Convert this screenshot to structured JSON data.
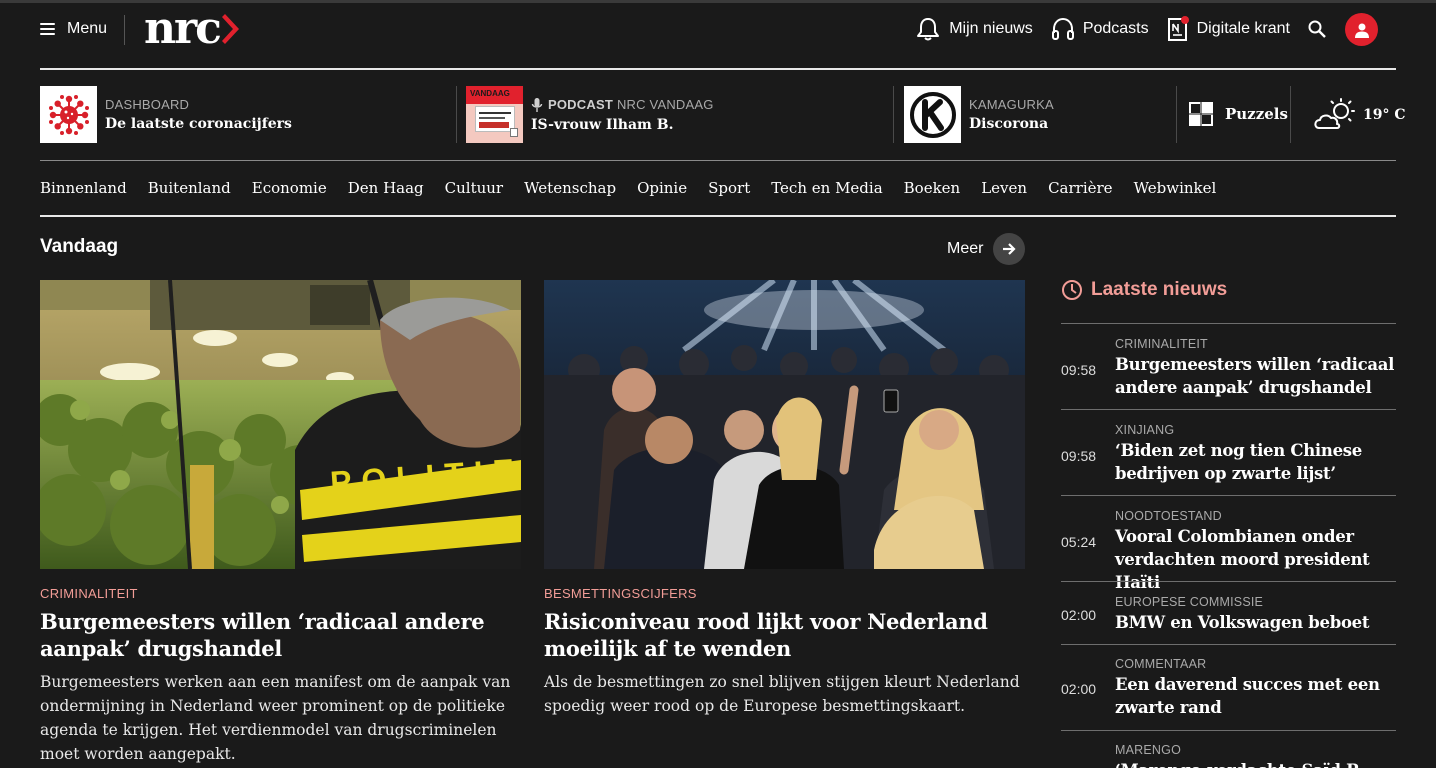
{
  "header": {
    "menu_label": "Menu",
    "logo_text": "nrc",
    "nav": [
      {
        "label": "Mijn nieuws",
        "icon": "bell-icon"
      },
      {
        "label": "Podcasts",
        "icon": "headphones-icon"
      },
      {
        "label": "Digitale krant",
        "icon": "newspaper-icon"
      }
    ]
  },
  "promos": [
    {
      "kicker_strong": "",
      "kicker": "DASHBOARD",
      "title": "De laatste coronacijfers",
      "icon": "virus-icon"
    },
    {
      "kicker_strong": "PODCAST",
      "kicker": "NRC VANDAAG",
      "title": "IS-vrouw Ilham B.",
      "icon": "podcast-cover",
      "cover_text": "VANDAAG"
    },
    {
      "kicker_strong": "",
      "kicker": "KAMAGURKA",
      "title": "Discorona",
      "icon": "kamagurka-k-logo"
    }
  ],
  "puzzels_label": "Puzzels",
  "weather": {
    "temp": "19° C",
    "icon": "partly-cloudy-icon"
  },
  "sections": [
    "Binnenland",
    "Buitenland",
    "Economie",
    "Den Haag",
    "Cultuur",
    "Wetenschap",
    "Opinie",
    "Sport",
    "Tech en Media",
    "Boeken",
    "Leven",
    "Carrière",
    "Webwinkel"
  ],
  "today": {
    "heading": "Vandaag",
    "more_label": "Meer",
    "articles": [
      {
        "kicker": "CRIMINALITEIT",
        "title": "Burgemeesters willen ‘radicaal andere aanpak’ drugshandel",
        "lede": "Burgemeesters werken aan een manifest om de aanpak van ondermijning in Nederland weer prominent op de politieke agenda te krijgen. Het verdienmodel van drugscriminelen moet worden aangepakt.",
        "image_text": "POLITIE"
      },
      {
        "kicker": "BESMETTINGSCIJFERS",
        "title": "Risiconiveau rood lijkt voor Nederland moeilijk af te wenden",
        "lede": "Als de besmettingen zo snel blijven stijgen kleurt Nederland spoedig weer rood op de Europese besmettingskaart."
      }
    ]
  },
  "latest": {
    "heading": "Laatste nieuws",
    "items": [
      {
        "time": "09:58",
        "kicker": "CRIMINALITEIT",
        "title": "Burgemeesters willen ‘radicaal andere aanpak’ drugshandel"
      },
      {
        "time": "09:58",
        "kicker": "XINJIANG",
        "title": "‘Biden zet nog tien Chinese bedrijven op zwarte lijst’"
      },
      {
        "time": "05:24",
        "kicker": "NOODTOESTAND",
        "title": "Vooral Colombianen onder verdachten moord president Haïti"
      },
      {
        "time": "02:00",
        "kicker": "EUROPESE COMMISSIE",
        "title": "BMW en Volkswagen beboet"
      },
      {
        "time": "02:00",
        "kicker": "COMMENTAAR",
        "title": "Een daverend succes met een zwarte rand"
      },
      {
        "time": "",
        "kicker": "MARENGO",
        "title": "‘Marengo-verdachte Saïd R. weg"
      }
    ]
  },
  "colors": {
    "background": "#1a1a1a",
    "brand_red": "#e1212d",
    "kicker_pink": "#f29d97"
  }
}
